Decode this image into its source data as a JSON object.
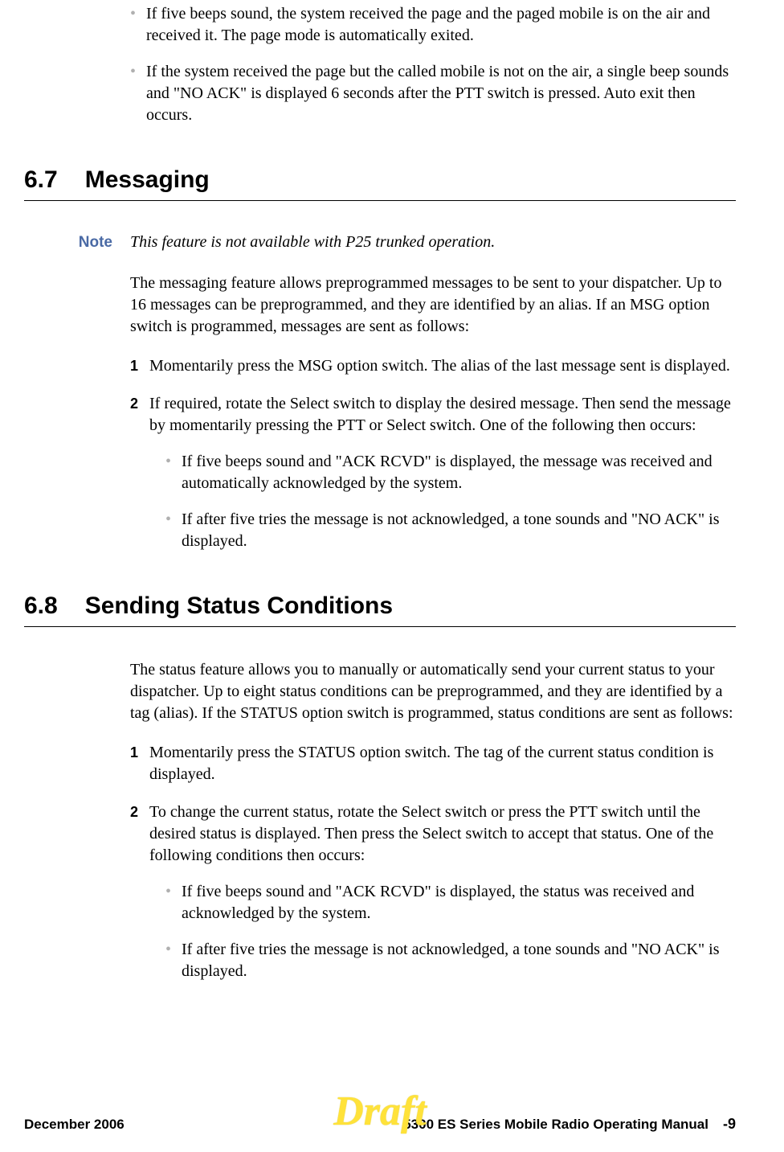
{
  "intro": {
    "bullets": [
      "If five beeps sound, the system received the page and the paged mobile is on the air and received it. The page mode is automatically exited.",
      "If the system received the page but the called mobile is not on the air, a single beep sounds and \"NO ACK\" is displayed 6 seconds after the PTT switch is pressed. Auto exit then occurs."
    ]
  },
  "sections": {
    "s67": {
      "number": "6.7",
      "title": "Messaging",
      "note_label": "Note",
      "note_text": "This feature is not available with P25 trunked operation.",
      "para": "The messaging feature allows preprogrammed messages to be sent to your dispatcher. Up to 16 messages can be preprogrammed, and they are identified by an alias. If an MSG option switch is programmed, messages are sent as follows:",
      "steps": [
        {
          "num": "1",
          "text": "Momentarily press the MSG option switch. The alias of the last message sent is displayed."
        },
        {
          "num": "2",
          "text": "If required, rotate the Select switch to display the desired message. Then send the message by momentarily pressing the PTT or Select switch. One of the following then occurs:"
        }
      ],
      "step2_sub": [
        "If five beeps sound and \"ACK RCVD\" is displayed, the message was received and automatically acknowledged by the system.",
        "If after five tries the message is not acknowledged, a tone sounds and \"NO ACK\" is displayed."
      ]
    },
    "s68": {
      "number": "6.8",
      "title": "Sending Status Conditions",
      "para": "The status feature allows you to manually or automatically send your current status to your dispatcher. Up to eight status conditions can be preprogrammed, and they are identified by a tag (alias). If the STATUS option switch is programmed, status conditions are sent as follows:",
      "steps": [
        {
          "num": "1",
          "text": "Momentarily press the STATUS option switch. The tag of the current status condition is displayed."
        },
        {
          "num": "2",
          "text": "To change the current status, rotate the Select switch or press the PTT switch until the desired status is displayed. Then press the Select switch to accept that status. One of the following conditions then occurs:"
        }
      ],
      "step2_sub": [
        "If five beeps sound and \"ACK RCVD\" is displayed, the status was received and acknowledged by the system.",
        "If after five tries the message is not acknowledged, a tone sounds and \"NO ACK\" is displayed."
      ]
    }
  },
  "footer": {
    "left": "December 2006",
    "center": "Draft",
    "right_title": "5300 ES Series Mobile Radio Operating Manual",
    "page": "-9"
  }
}
